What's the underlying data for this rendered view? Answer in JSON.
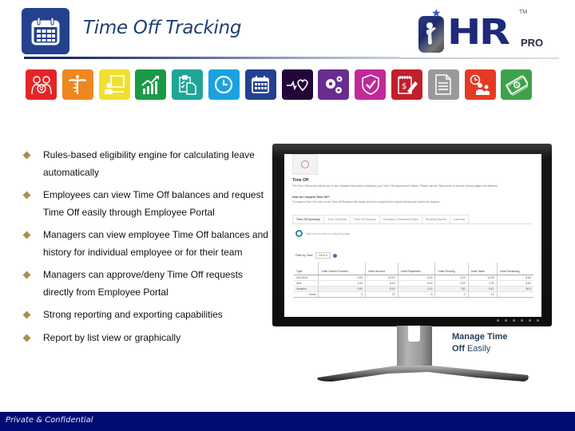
{
  "header": {
    "title": "Time Off Tracking",
    "title_icon": "calendar-icon",
    "logo": {
      "main": "HR",
      "suffix": "PRO",
      "trademark": "TM"
    }
  },
  "module_icons": [
    {
      "name": "employees-heart-icon",
      "color": "#e42528"
    },
    {
      "name": "caduceus-medical-icon",
      "color": "#f0861f"
    },
    {
      "name": "training-presenter-icon",
      "color": "#f0e030"
    },
    {
      "name": "growth-chart-icon",
      "color": "#1a9a48"
    },
    {
      "name": "clipboard-documents-icon",
      "color": "#1fa596"
    },
    {
      "name": "clock-icon",
      "color": "#1aa2e0"
    },
    {
      "name": "calendar-icon",
      "color": "#23418f"
    },
    {
      "name": "heartbeat-icon",
      "color": "#22063a"
    },
    {
      "name": "gears-icon",
      "color": "#6a2c8e"
    },
    {
      "name": "aca-shield-check-icon",
      "color": "#c02a98"
    },
    {
      "name": "expense-notepad-icon",
      "color": "#c0202c"
    },
    {
      "name": "document-icon",
      "color": "#9a9a9a"
    },
    {
      "name": "time-team-icon",
      "color": "#e43a24"
    },
    {
      "name": "money-icon",
      "color": "#3fa24a"
    }
  ],
  "bullets": [
    "Rules-based eligibility engine for calculating leave automatically",
    "Employees can view Time Off balances and request Time Off easily through Employee Portal",
    "Managers can view employee Time Off balances and history for individual employee or for their team",
    "Managers can approve/deny Time Off requests directly from Employee Portal",
    "Strong reporting and exporting capabilities",
    "Report by list view or graphically"
  ],
  "bullet_color": "#a89050",
  "screen": {
    "title": "Time Off",
    "description": "The Time Off section allows you to see valuable information relating to your Time Off requests and history. Please use the Tabs below to access various pages and features.",
    "question": "How do I request Time Off?",
    "answer": "To request Time Off, click on the Time Off Request Tab below and then complete the required fields and submit the request.",
    "tabs": [
      {
        "label": "Time Off Summary",
        "active": true
      },
      {
        "label": "Time Off Detail",
        "active": false
      },
      {
        "label": "Time Off Request",
        "active": false
      },
      {
        "label": "Holidays & Protected Dates",
        "active": false
      },
      {
        "label": "Pending Results",
        "active": false
      },
      {
        "label": "Calendar",
        "active": false
      }
    ],
    "help_text": "click here for help on using this page",
    "filter": {
      "label": "Filter by Year:",
      "value": "2015"
    },
    "table": {
      "headers": [
        "Type",
        "Units Carried Forward",
        "Units accrued",
        "Units Requested",
        "Units Pending",
        "Units Taken",
        "Units Remaining"
      ],
      "rows": [
        [
          "HOLIDAY",
          "0.00",
          "22.00",
          "0.00",
          "3.25",
          "14.25",
          "8.50"
        ],
        [
          "Sick",
          "0.00",
          "8.00",
          "0.00",
          "3.25",
          "2.25",
          "8.50"
        ],
        [
          "Vacation",
          "0.00",
          "8.00",
          "0.16",
          "7.50",
          "5.67",
          "46.5"
        ]
      ],
      "totals": [
        "Totals",
        "5",
        "22",
        "8",
        "2",
        "14",
        ""
      ]
    }
  },
  "caption": {
    "bold": "Manage Time Off",
    "rest": "Easily"
  },
  "caption_line1": "Manage Time",
  "caption_line2_bold": "Off",
  "caption_line2_rest": "Easily",
  "footer": {
    "text": "Private & Confidential"
  }
}
